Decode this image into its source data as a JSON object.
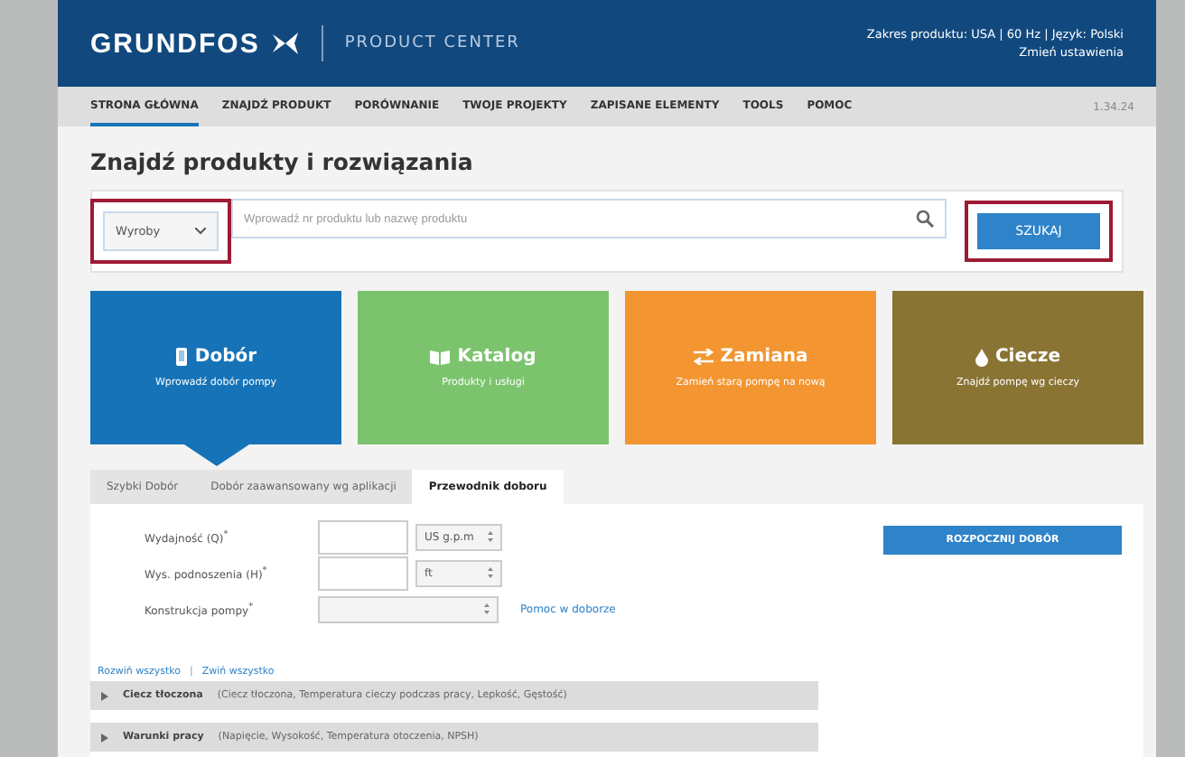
{
  "header": {
    "logo": "GRUNDFOS",
    "product": "PRODUCT CENTER",
    "settings": "Zakres produktu: USA | 60 Hz | Język: Polski",
    "settings_link": "Zmień ustawienia"
  },
  "nav": {
    "items": [
      {
        "label": "STRONA GŁÓWNA",
        "selected": true
      },
      {
        "label": "ZNAJDŹ PRODUKT",
        "selected": false
      },
      {
        "label": "PORÓWNANIE",
        "selected": false
      },
      {
        "label": "TWOJE PROJEKTY",
        "selected": false
      },
      {
        "label": "ZAPISANE ELEMENTY",
        "selected": false
      },
      {
        "label": "TOOLS",
        "selected": false
      },
      {
        "label": "POMOC",
        "selected": false
      }
    ],
    "version": "1.34.24"
  },
  "heading": "Znajdź produkty i rozwiązania",
  "search": {
    "category": "Wyroby",
    "category_highlighted": true,
    "placeholder": "Wprowadź nr produktu lub nazwę produktu",
    "button": "SZUKAJ",
    "button_highlighted": true
  },
  "tiles": [
    {
      "kind": "selection",
      "title": "Dobór",
      "subtitle": "Wprowadź dobór pompy",
      "color": "#1673b8",
      "selected": true
    },
    {
      "kind": "catalog",
      "title": "Katalog",
      "subtitle": "Produkty i usługi",
      "color": "#7cc36e",
      "selected": false
    },
    {
      "kind": "replace",
      "title": "Zamiana",
      "subtitle": "Zamień starą pompę na nową",
      "color": "#f39531",
      "selected": false
    },
    {
      "kind": "liquid",
      "title": "Ciecze",
      "subtitle": "Znajdź pompę wg cieczy",
      "color": "#8a7434",
      "selected": false
    }
  ],
  "tabs": [
    {
      "label": "Szybki Dobór",
      "selected": false
    },
    {
      "label": "Dobór zaawansowany wg aplikacji",
      "selected": false
    },
    {
      "label": "Przewodnik doboru",
      "selected": true
    }
  ],
  "form": [
    {
      "label": "Wydajność (Q)$^{*}$",
      "unit": "US g.p.m"
    },
    {
      "label": "Wys. podnoszenia (H)$^{*}$",
      "unit": "ft"
    },
    {
      "label": "Konstrukcja pompy$^{*}$",
      "help": "Pomoc w doborze"
    }
  ],
  "expand_all": "Rozwiń wszystko",
  "links_separator": "|",
  "collapse_all": "Zwiń wszystko",
  "sections": [
    {
      "title": "Ciecz tłoczona",
      "details": "(Ciecz tłoczona, Temperatura cieczy podczas pracy, Lepkość, Gęstość)"
    },
    {
      "title": "Warunki pracy",
      "details": "(Napięcie, Wysokość, Temperatura otoczenia, NPSH)"
    }
  ],
  "start_button": "ROZPOCZNIJ DOBÓR"
}
